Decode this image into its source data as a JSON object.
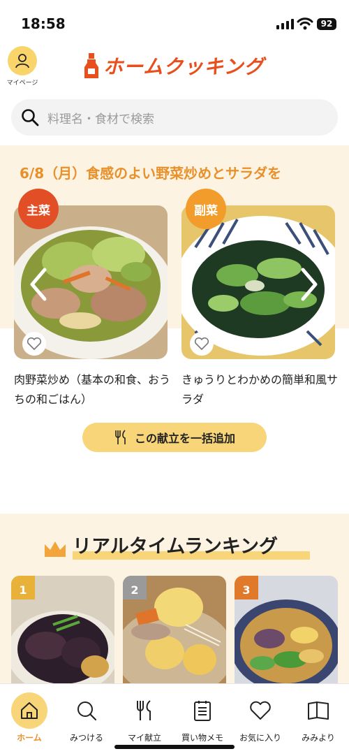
{
  "status": {
    "time": "18:58",
    "battery": "92"
  },
  "header": {
    "mypage_label": "マイページ",
    "logo_text": "ホームクッキング"
  },
  "search": {
    "placeholder": "料理名・食材で検索"
  },
  "menu": {
    "title": "6/8（月）食感のよい野菜炒めとサラダを",
    "items": [
      {
        "badge": "主菜",
        "name": "肉野菜炒め（基本の和食、おうちの和ごはん）"
      },
      {
        "badge": "副菜",
        "name": "きゅうりとわかめの簡単和風サラダ"
      }
    ],
    "add_button": "この献立を一括追加"
  },
  "ranking": {
    "title": "リアルタイムランキング",
    "ranks": [
      "1",
      "2",
      "3"
    ]
  },
  "tabs": [
    {
      "label": "ホーム"
    },
    {
      "label": "みつける"
    },
    {
      "label": "マイ献立"
    },
    {
      "label": "買い物メモ"
    },
    {
      "label": "お気に入り"
    },
    {
      "label": "みみより"
    }
  ],
  "colors": {
    "accent": "#e8902a",
    "brand": "#e84f1c",
    "yellow": "#f8d578",
    "cream": "#fdf3e2"
  }
}
